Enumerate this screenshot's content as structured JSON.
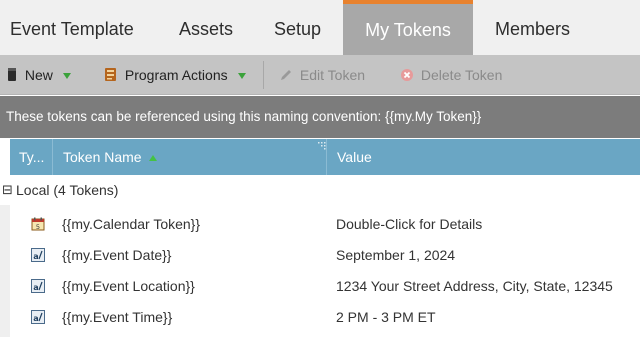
{
  "tabs": [
    {
      "label": "Event Template",
      "active": false
    },
    {
      "label": "Assets",
      "active": false
    },
    {
      "label": "Setup",
      "active": false
    },
    {
      "label": "My Tokens",
      "active": true
    },
    {
      "label": "Members",
      "active": false
    }
  ],
  "toolbar": {
    "new_label": "New",
    "program_actions_label": "Program Actions",
    "edit_token_label": "Edit Token",
    "delete_token_label": "Delete Token"
  },
  "info": {
    "text": "These tokens can be referenced using this naming convention: {{my.My Token}}"
  },
  "grid": {
    "columns": {
      "type": "Ty...",
      "name": "Token Name",
      "value": "Value"
    },
    "group": {
      "toggle": "⊟",
      "label": "Local (4 Tokens)"
    },
    "rows": [
      {
        "icon": "calendar-token-icon",
        "name": "{{my.Calendar Token}}",
        "value": "Double-Click for Details"
      },
      {
        "icon": "text-token-icon",
        "name": "{{my.Event Date}}",
        "value": "September 1, 2024"
      },
      {
        "icon": "text-token-icon",
        "name": "{{my.Event Location}}",
        "value": "1234 Your Street Address, City, State, 12345"
      },
      {
        "icon": "text-token-icon",
        "name": "{{my.Event Time}}",
        "value": "2 PM - 3 PM ET"
      }
    ]
  },
  "colors": {
    "active_tab_accent": "#e8822e",
    "header_blue": "#6aa6c4",
    "info_bar": "#7c7c7c",
    "toolbar": "#c4c4c4"
  }
}
